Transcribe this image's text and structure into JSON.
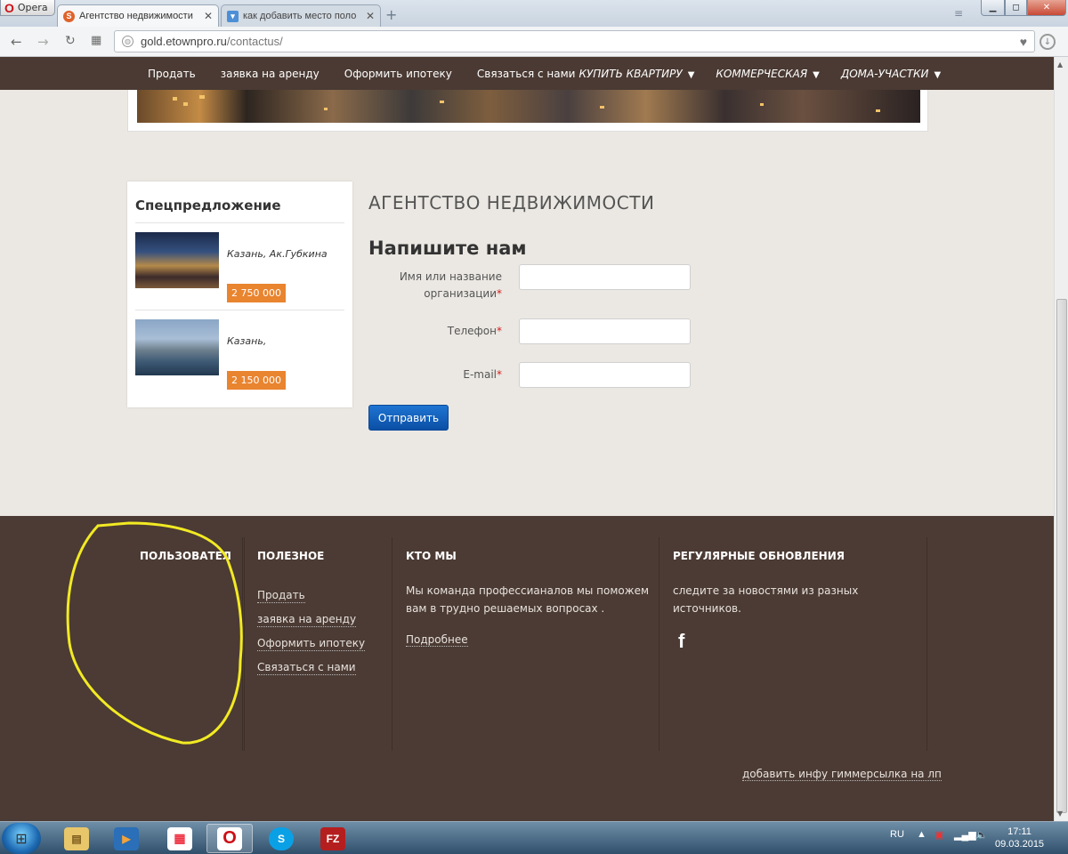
{
  "browser": {
    "app_name": "Opera",
    "tabs": [
      {
        "title": "Агентство недвижимости",
        "favicon": "S"
      },
      {
        "title": "как добавить место поло"
      }
    ],
    "url_host": "gold.etownpro.ru",
    "url_path": "/contactus/"
  },
  "nav": {
    "items": [
      "Продать",
      "заявка на аренду",
      "Оформить ипотеку",
      "Связаться с нами"
    ],
    "categories": [
      "КУПИТЬ КВАРТИРУ",
      "КОММЕРЧЕСКАЯ",
      "ДОМА-УЧАСТКИ"
    ]
  },
  "sidebar": {
    "title": "Спецпредложение",
    "offers": [
      {
        "city": "Казань, Ак.Губкина",
        "price": "2 750 000"
      },
      {
        "city": "Казань,",
        "price": "2 150 000"
      }
    ]
  },
  "content": {
    "title": "АГЕНТСТВО НЕДВИЖИМОСТИ",
    "form_title": "Напишите нам",
    "fields": [
      {
        "label_line1": "Имя или название",
        "label_line2": "организации",
        "value": ""
      },
      {
        "label": "Телефон",
        "value": ""
      },
      {
        "label": "E-mail",
        "value": ""
      }
    ],
    "required_mark": "*",
    "submit_label": "Отправить"
  },
  "footer": {
    "col1_title": "ПОЛЬЗОВАТЕЛ",
    "col2_title": "ПОЛЕЗНОЕ",
    "col2_links": [
      "Продать",
      "заявка на аренду",
      "Оформить ипотеку",
      "Связаться с нами"
    ],
    "col3_title": "КТО МЫ",
    "col3_text_line1": "Мы команда профессианалов мы поможем",
    "col3_text_line2": "вам в трудно решаемых вопросах .",
    "col3_more": "Подробнее",
    "col4_title": "РЕГУЛЯРНЫЕ ОБНОВЛЕНИЯ",
    "col4_text": "следите за новостями из разных источников.",
    "bottom_link": "добавить инфу гиммерсылка на лп"
  },
  "taskbar": {
    "lang": "RU",
    "time": "17:11",
    "date": "09.03.2015"
  },
  "colors": {
    "nav_bg": "#4a3a33",
    "footer_bg": "#4b3b34",
    "price_badge": "#e9842f",
    "submit_button": "#0b4fa5",
    "required": "#d32020",
    "annotation": "#f2ea23"
  },
  "icons": [
    "opera-logo-icon",
    "back-icon",
    "forward-icon",
    "reload-icon",
    "speed-dial-icon",
    "globe-icon",
    "heart-icon",
    "download-icon",
    "chevron-down-icon",
    "facebook-icon",
    "windows-start-icon"
  ]
}
